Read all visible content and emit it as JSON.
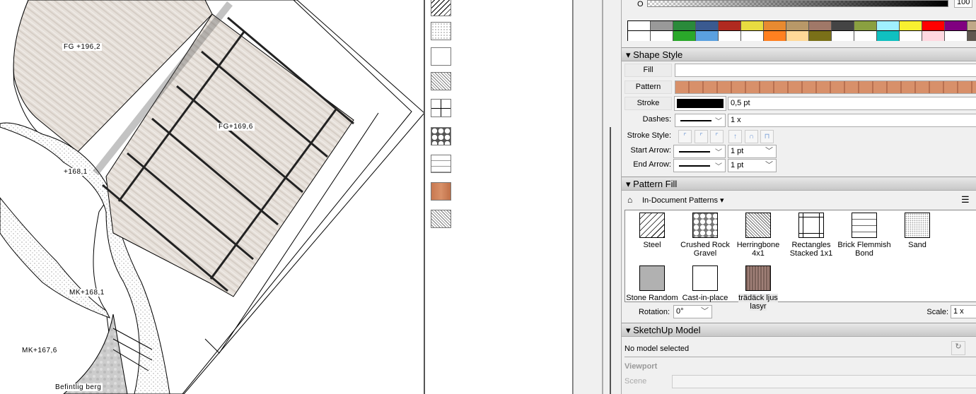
{
  "canvas": {
    "labels": [
      "FG +196,2",
      "FG+169,6",
      "+168,1",
      "MK+168,1",
      "MK+167,6",
      "Befintlig berg"
    ]
  },
  "opacity": {
    "label": "O",
    "value": "100"
  },
  "palette": {
    "row1": [
      "#ffffff",
      "#999999",
      "#2a8a3a",
      "#3a5a90",
      "#b02a20",
      "#e8dc40",
      "#e88a30",
      "#b89868",
      "#a07868",
      "#444444",
      "#8aa040",
      "#a0f0ff",
      "#f8f030",
      "#ff0000",
      "#800080",
      "#c0a888"
    ],
    "row2": [
      "#ffffff",
      "#ffffff",
      "#2aa82a",
      "#5aa0e0",
      "#ffffff",
      "#ffffff",
      "#ff8020",
      "#ffd898",
      "#7a7018",
      "#ffffff",
      "#ffffff",
      "#10c0c0",
      "#ffffff",
      "#ffd8e0",
      "#ffffff",
      "#605850"
    ]
  },
  "shape_style": {
    "title": "Shape Style",
    "fill_label": "Fill",
    "pattern_label": "Pattern",
    "stroke_label": "Stroke",
    "stroke_width": "0,5 pt",
    "dashes_label": "Dashes:",
    "dashes_scale": "1 x",
    "stroke_style_label": "Stroke Style:",
    "start_arrow_label": "Start Arrow:",
    "start_arrow_size": "1 pt",
    "end_arrow_label": "End Arrow:",
    "end_arrow_size": "1 pt"
  },
  "pattern_fill": {
    "title": "Pattern Fill",
    "source": "In-Document Patterns",
    "patterns": [
      {
        "name": "Steel"
      },
      {
        "name": "Crushed Rock Gravel"
      },
      {
        "name": "Herringbone 4x1"
      },
      {
        "name": "Rectangles Stacked 1x1"
      },
      {
        "name": "Brick Flemmish Bond"
      },
      {
        "name": "Sand"
      },
      {
        "name": "Stone Random"
      },
      {
        "name": "Cast-in-place"
      },
      {
        "name": "trädäck ljus lasyr"
      }
    ],
    "rotation_label": "Rotation:",
    "rotation_value": "0°",
    "scale_label": "Scale:",
    "scale_value": "1 x"
  },
  "sketchup": {
    "title": "SketchUp Model",
    "status": "No model selected",
    "viewport_label": "Viewport",
    "scene_label": "Scene"
  }
}
